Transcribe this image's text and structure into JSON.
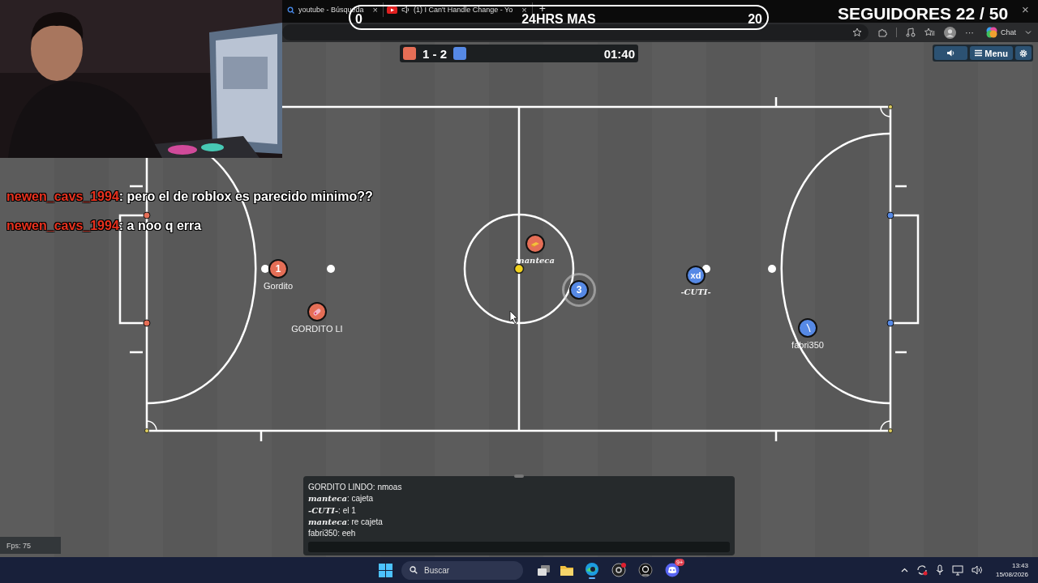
{
  "browser": {
    "tabs": [
      {
        "title": "youtube - Búsqueda",
        "close": "×"
      },
      {
        "title": "(1) I Can't Handle Change - Yo",
        "close": "×"
      }
    ],
    "new_tab": "+",
    "toolbar": {
      "more": "···",
      "chat_label": "Chat"
    }
  },
  "overlay": {
    "goal_bar": {
      "start": "0",
      "title": "24HRS MAS",
      "end": "20",
      "level": 0
    },
    "followers": "SEGUIDORES 22 / 50",
    "window_close": "×",
    "stream_chat": [
      {
        "user": "newen_cavs_1994",
        "message": ": pero el de roblox es parecido minimo??"
      },
      {
        "user": "newen_cavs_1994",
        "message": ": a noo q erra"
      }
    ]
  },
  "game": {
    "scoreboard": {
      "score": "1 - 2",
      "time": "01:40"
    },
    "menu_button": "Menu",
    "players": [
      {
        "color": "#e56e56",
        "kind": "text",
        "avatar": "1",
        "name": "Gordito",
        "script_name": false,
        "kicking": false
      },
      {
        "color": "#e56e56",
        "kind": "icon",
        "name": "GORDITO LI",
        "script_name": false,
        "kicking": false
      },
      {
        "color": "#e56e56",
        "kind": "icon",
        "name": "manteca",
        "script_name": true,
        "kicking": false
      },
      {
        "color": "#5689e5",
        "kind": "text",
        "avatar": "3",
        "kicking": true
      },
      {
        "color": "#5689e5",
        "kind": "text",
        "avatar": "xd",
        "name": "-CUTI-",
        "script_name": true,
        "kicking": false
      },
      {
        "color": "#5689e5",
        "kind": "icon",
        "name": "fabri350",
        "script_name": false,
        "kicking": false
      }
    ],
    "chat": {
      "messages": [
        "GORDITO LINDO: nmoas",
        "**manteca**: cajeta",
        "**-CUTI-**: el 1",
        "**manteca**: re cajeta",
        "fabri350: eeh"
      ]
    },
    "fps": "Fps: 75"
  },
  "taskbar": {
    "search_placeholder": "Buscar",
    "app_badge": "9+",
    "time": "13:43",
    "date": "15/08/2026"
  }
}
